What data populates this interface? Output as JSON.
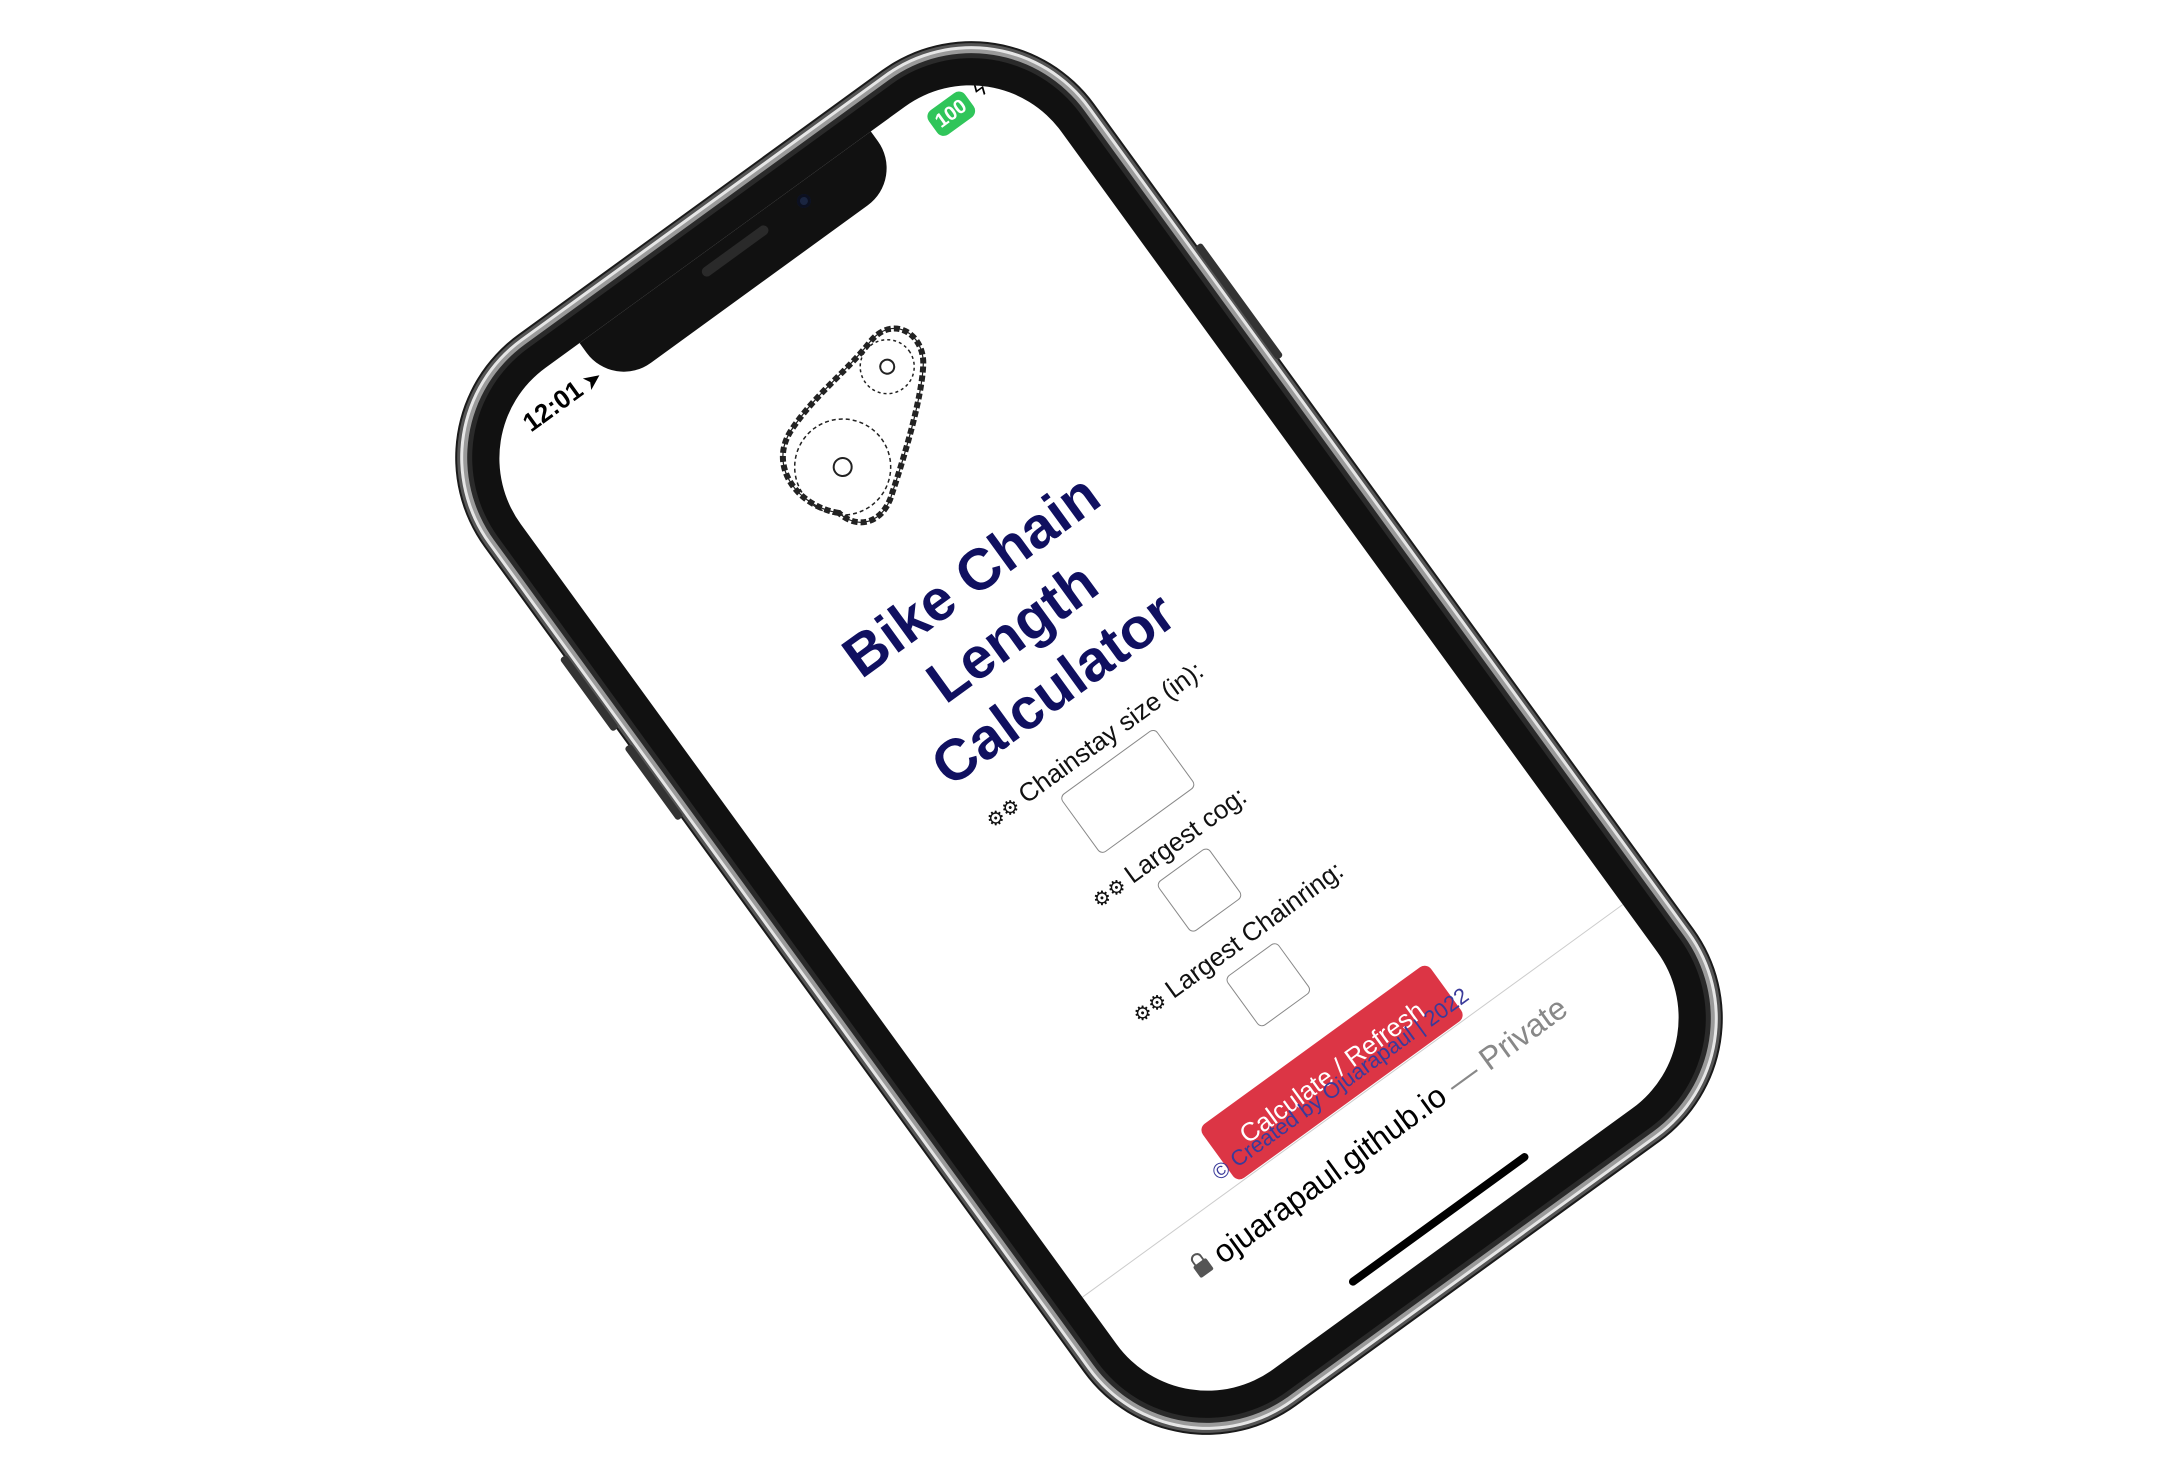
{
  "status_bar": {
    "time": "12:01",
    "location_arrow": "➤",
    "battery": "100",
    "charging_symbol": "ϟ"
  },
  "page": {
    "title_line_1": "Bike Chain",
    "title_line_2": "Length",
    "title_line_3": "Calculator",
    "gear_symbol": "⚙⚙"
  },
  "form": {
    "chainstay_label": "Chainstay size (in):",
    "chainstay_value": "",
    "cog_label": "Largest cog:",
    "cog_value": "",
    "chainring_label": "Largest Chainring:",
    "chainring_value": "",
    "button_label": "Calculate / Refresh"
  },
  "footer": {
    "credit": "© Created by Ojuarapaul | 2022"
  },
  "browser": {
    "domain": "ojuarapaul.github.io",
    "separator": " — ",
    "mode": "Private"
  },
  "colors": {
    "title": "#101060",
    "button": "#dc3545",
    "battery": "#30c55a",
    "credit": "#3a3a9a"
  },
  "icons": [
    "location-arrow-icon",
    "battery-icon",
    "chain-sprocket-illustration",
    "gear-icon",
    "lock-icon"
  ]
}
